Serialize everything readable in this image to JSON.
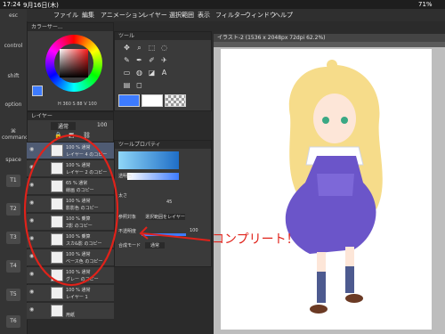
{
  "status": {
    "time": "17:24",
    "date": "9月16日(木)",
    "battery": "71%"
  },
  "menu": [
    "ファイル",
    "編集",
    "アニメーション",
    "レイヤー",
    "選択範囲",
    "表示",
    "フィルター",
    "ウィンドウ",
    "ヘルプ"
  ],
  "leftbar": {
    "esc": "esc",
    "control": "control",
    "shift": "shift",
    "option": "option",
    "command": "command",
    "space": "space",
    "keys": [
      "T1",
      "T2",
      "T3",
      "T4",
      "T5",
      "T6"
    ]
  },
  "color_panel": {
    "title": "カラーサー...",
    "hsv": "H 360 S 88 V 100"
  },
  "tool_panel": {
    "title": "ツール"
  },
  "layer_panel": {
    "title": "レイヤー",
    "blend": "通常",
    "opacity": "100"
  },
  "tool_property": {
    "title": "ツールプロパティ",
    "label_transparent": "透明色",
    "label_thickness": "太さ",
    "thickness_value": "45",
    "label_reference": "参照対象",
    "reference_value": "選択範囲をレイヤー",
    "label_opacity": "不透明度",
    "opacity_value": "100",
    "label_blend": "合成モード",
    "blend_value": "通常"
  },
  "canvas": {
    "tab": "イラスト-2 (1536 x 2048px 72dpi 62.2%)"
  },
  "annotation": "コンプリート！",
  "layers": [
    {
      "l1": "100 % 通常",
      "l2": "レイヤー 4 のコピー",
      "selected": true
    },
    {
      "l1": "100 % 通常",
      "l2": "レイヤー 2 のコピー",
      "selected": false
    },
    {
      "l1": "65 % 通常",
      "l2": "線画 のコピー",
      "selected": false
    },
    {
      "l1": "100 % 通常",
      "l2": "影影色 のコピー",
      "selected": false
    },
    {
      "l1": "100 % 乗算",
      "l2": "2影 のコピー",
      "selected": false
    },
    {
      "l1": "100 % 乗算",
      "l2": "スカ&影 のコピー",
      "selected": false
    },
    {
      "l1": "100 % 通常",
      "l2": "ベース色 のコピー",
      "selected": false
    },
    {
      "l1": "100 % 通常",
      "l2": "グレー のコピー",
      "selected": false
    },
    {
      "l1": "100 % 通常",
      "l2": "レイヤー 1",
      "selected": false
    },
    {
      "l1": "",
      "l2": "用紙",
      "selected": false
    }
  ],
  "colors": {
    "accent": "#3d7bff",
    "highlight": "#e0221a",
    "selected_layer": "#4f5b73"
  },
  "icons": [
    "eye-icon",
    "pen-icon",
    "eraser-icon",
    "fill-icon",
    "eyedropper-icon",
    "move-icon",
    "select-icon",
    "text-icon"
  ]
}
